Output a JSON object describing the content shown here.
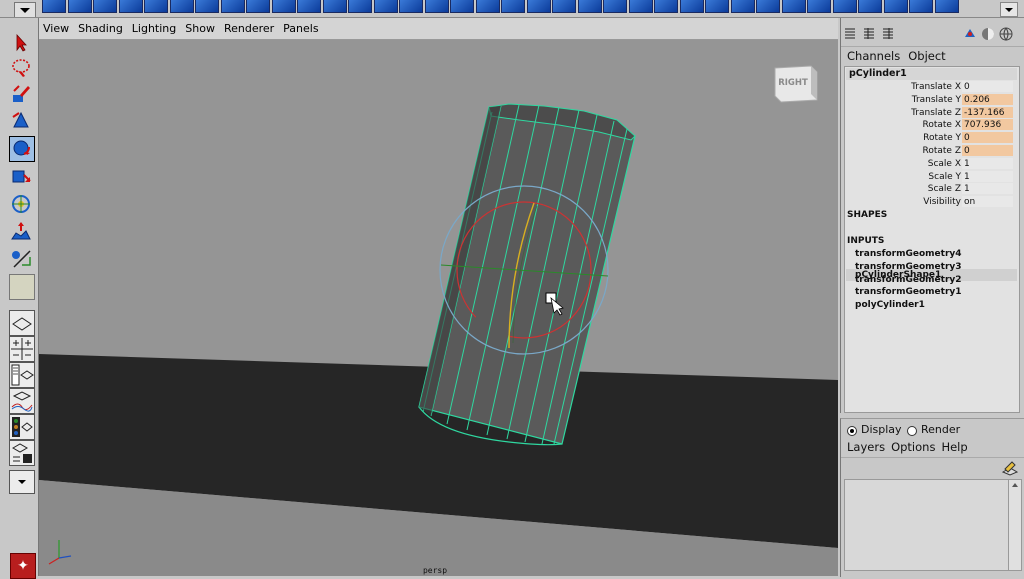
{
  "viewport": {
    "menu": [
      "View",
      "Shading",
      "Lighting",
      "Show",
      "Renderer",
      "Panels"
    ],
    "camera_label": "persp",
    "view_cube_label": "RIGHT"
  },
  "channel_box": {
    "menu": [
      "Channels",
      "Object"
    ],
    "object_name": "pCylinder1",
    "attributes": [
      {
        "label": "Translate X",
        "value": "0",
        "highlight": false
      },
      {
        "label": "Translate Y",
        "value": "0.206",
        "highlight": true
      },
      {
        "label": "Translate Z",
        "value": "-137.166",
        "highlight": true
      },
      {
        "label": "Rotate X",
        "value": "707.936",
        "highlight": true
      },
      {
        "label": "Rotate Y",
        "value": "0",
        "highlight": true
      },
      {
        "label": "Rotate Z",
        "value": "0",
        "highlight": true
      },
      {
        "label": "Scale X",
        "value": "1",
        "highlight": false
      },
      {
        "label": "Scale Y",
        "value": "1",
        "highlight": false
      },
      {
        "label": "Scale Z",
        "value": "1",
        "highlight": false
      },
      {
        "label": "Visibility",
        "value": "on",
        "highlight": false
      }
    ],
    "shapes_header": "SHAPES",
    "shape_name": "pCylinderShape1",
    "inputs_header": "INPUTS",
    "inputs": [
      "transformGeometry4",
      "transformGeometry3",
      "transformGeometry2",
      "transformGeometry1",
      "polyCylinder1"
    ]
  },
  "layer_editor": {
    "modes": [
      "Display",
      "Render"
    ],
    "selected_mode": "Display",
    "menu": [
      "Layers",
      "Options",
      "Help"
    ]
  },
  "colors": {
    "wireframe": "#2fd8a0",
    "selection_highlight": "#9ebfe4",
    "attr_highlight": "#f2c8a0"
  }
}
